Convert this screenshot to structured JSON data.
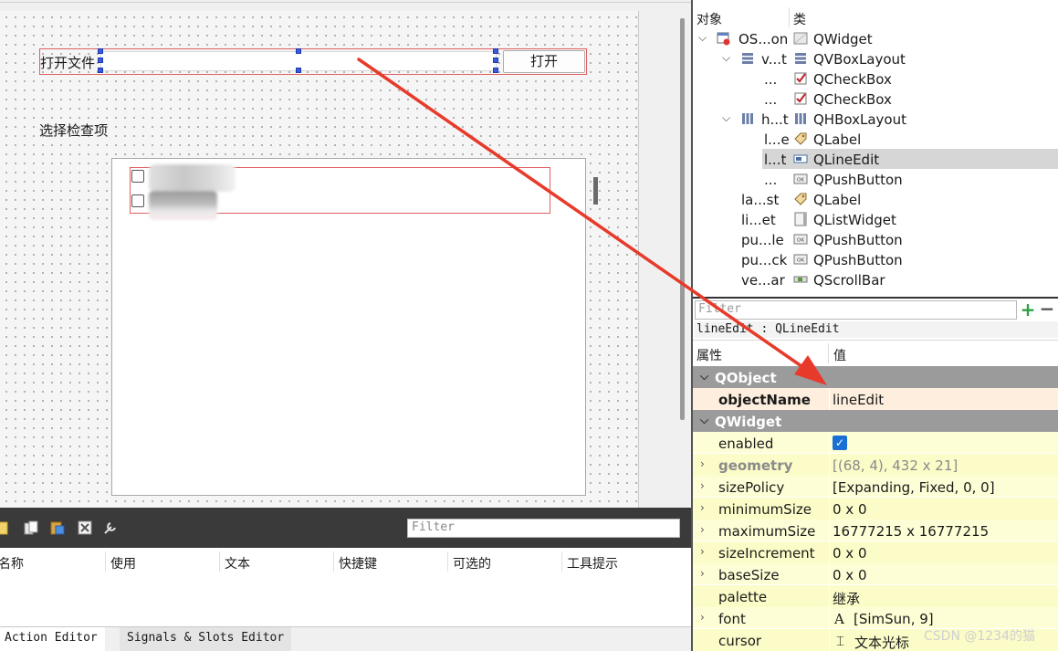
{
  "form": {
    "open_label": "打开文件",
    "open_button": "打开",
    "check_label": "选择检查项"
  },
  "action_editor": {
    "filter_placeholder": "Filter",
    "columns": [
      "名称",
      "使用",
      "文本",
      "快捷键",
      "可选的",
      "工具提示"
    ],
    "tabs": [
      "Action Editor",
      "Signals & Slots Editor"
    ]
  },
  "object_inspector": {
    "col_object": "对象",
    "col_class": "类",
    "rows": [
      {
        "name": "OS...on",
        "class": "QWidget"
      },
      {
        "name": "v...t",
        "class": "QVBoxLayout"
      },
      {
        "name": "...",
        "class": "QCheckBox"
      },
      {
        "name": "...",
        "class": "QCheckBox"
      },
      {
        "name": "h...t",
        "class": "QHBoxLayout"
      },
      {
        "name": "l...e",
        "class": "QLabel"
      },
      {
        "name": "l...t",
        "class": "QLineEdit"
      },
      {
        "name": "...",
        "class": "QPushButton"
      },
      {
        "name": "la...st",
        "class": "QLabel"
      },
      {
        "name": "li...et",
        "class": "QListWidget"
      },
      {
        "name": "pu...le",
        "class": "QPushButton"
      },
      {
        "name": "pu...ck",
        "class": "QPushButton"
      },
      {
        "name": "ve...ar",
        "class": "QScrollBar"
      }
    ]
  },
  "property_editor": {
    "filter_placeholder": "Filter",
    "caption": "lineEdit : QLineEdit",
    "col_property": "属性",
    "col_value": "值",
    "groups": {
      "qobject": "QObject",
      "qwidget": "QWidget"
    },
    "props": {
      "objectName": {
        "name": "objectName",
        "value": "lineEdit"
      },
      "enabled": {
        "name": "enabled",
        "value": "✓"
      },
      "geometry": {
        "name": "geometry",
        "value": "[(68, 4), 432 x 21]"
      },
      "sizePolicy": {
        "name": "sizePolicy",
        "value": "[Expanding, Fixed, 0, 0]"
      },
      "minimumSize": {
        "name": "minimumSize",
        "value": "0 x 0"
      },
      "maximumSize": {
        "name": "maximumSize",
        "value": "16777215 x 16777215"
      },
      "sizeIncrement": {
        "name": "sizeIncrement",
        "value": "0 x 0"
      },
      "baseSize": {
        "name": "baseSize",
        "value": "0 x 0"
      },
      "palette": {
        "name": "palette",
        "value": "继承"
      },
      "font": {
        "name": "font",
        "value": "[SimSun, 9]"
      },
      "cursor": {
        "name": "cursor",
        "value": "文本光标"
      }
    }
  },
  "watermark": "CSDN @1234的猫",
  "colors": {
    "selection_border": "#e06060",
    "handle": "#3a5bd9",
    "arrow": "#e83a2a",
    "group_header": "#9b9b9b",
    "prop_yellow": "#fefed6"
  }
}
